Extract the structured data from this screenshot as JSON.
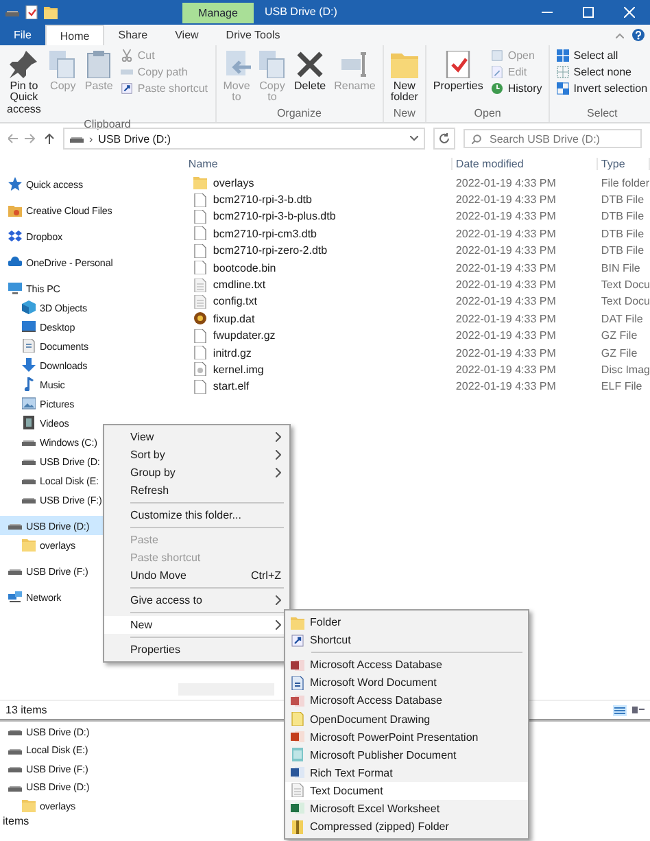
{
  "window": {
    "title": "USB Drive (D:)",
    "contextual_tab": "Manage"
  },
  "ribbon_tabs": [
    {
      "label": "File",
      "kind": "file"
    },
    {
      "label": "Home",
      "selected": true
    },
    {
      "label": "Share",
      "selected": false
    },
    {
      "label": "View",
      "selected": false
    },
    {
      "label": "Drive Tools",
      "selected": false
    }
  ],
  "ribbon_groups": [
    {
      "label": "Clipboard",
      "items": [
        {
          "label": "Pin to Quick access",
          "kind": "large",
          "disabled": false
        },
        {
          "label": "Copy",
          "kind": "large",
          "disabled": true
        },
        {
          "label": "Paste",
          "kind": "large",
          "disabled": true
        },
        {
          "kind": "stack",
          "items": [
            {
              "label": "Cut",
              "disabled": true
            },
            {
              "label": "Copy path",
              "disabled": true
            },
            {
              "label": "Paste shortcut",
              "disabled": true
            }
          ]
        }
      ]
    },
    {
      "label": "Organize",
      "items": [
        {
          "label": "Move to",
          "kind": "large",
          "disabled": true
        },
        {
          "label": "Copy to",
          "kind": "large",
          "disabled": true
        },
        {
          "label": "Delete",
          "kind": "large",
          "disabled": false
        },
        {
          "label": "Rename",
          "kind": "large",
          "disabled": true
        }
      ]
    },
    {
      "label": "New",
      "items": [
        {
          "label": "New folder",
          "kind": "large",
          "disabled": false
        }
      ]
    },
    {
      "label": "Open",
      "items": [
        {
          "label": "Properties",
          "kind": "large",
          "disabled": false
        },
        {
          "kind": "stack",
          "items": [
            {
              "label": "Open",
              "disabled": true
            },
            {
              "label": "Edit",
              "disabled": true
            },
            {
              "label": "History",
              "disabled": false
            }
          ]
        }
      ]
    },
    {
      "label": "Select",
      "items": [
        {
          "kind": "stack",
          "items": [
            {
              "label": "Select all",
              "disabled": false
            },
            {
              "label": "Select none",
              "disabled": false
            },
            {
              "label": "Invert selection",
              "disabled": false
            }
          ]
        }
      ]
    }
  ],
  "address": {
    "separator": "›",
    "path": "USB Drive (D:)",
    "search_placeholder": "Search USB Drive (D:)"
  },
  "nav": [
    {
      "label": "Quick access",
      "kind": "star",
      "selected": false
    },
    {
      "label": "Creative Cloud Files",
      "kind": "cloudfolder",
      "selected": false
    },
    {
      "label": "Dropbox",
      "kind": "box",
      "selected": false
    },
    {
      "label": "OneDrive - Personal",
      "kind": "cloud",
      "selected": false
    },
    {
      "label": "This PC",
      "kind": "pc",
      "selected": false,
      "children": [
        {
          "label": "3D Objects",
          "kind": "cube",
          "selected": false
        },
        {
          "label": "Desktop",
          "kind": "desktop",
          "selected": false
        },
        {
          "label": "Documents",
          "kind": "doc",
          "selected": false
        },
        {
          "label": "Downloads",
          "kind": "download",
          "selected": false
        },
        {
          "label": "Music",
          "kind": "music",
          "selected": false
        },
        {
          "label": "Pictures",
          "kind": "pictures",
          "selected": false
        },
        {
          "label": "Videos",
          "kind": "video",
          "selected": false
        },
        {
          "label": "Windows (C:)",
          "kind": "drive",
          "selected": false
        },
        {
          "label": "USB Drive (D:",
          "kind": "drive",
          "selected": false
        },
        {
          "label": "Local Disk (E:",
          "kind": "drive",
          "selected": false
        },
        {
          "label": "USB Drive (F:)",
          "kind": "drive",
          "selected": false
        }
      ]
    },
    {
      "label": "USB Drive (D:)",
      "kind": "drive",
      "selected": true,
      "children": [
        {
          "label": "overlays",
          "kind": "folder",
          "selected": false
        }
      ]
    },
    {
      "label": "USB Drive (F:)",
      "kind": "drive",
      "selected": false
    },
    {
      "label": "Network",
      "kind": "network",
      "selected": false
    }
  ],
  "table": {
    "columns": [
      "Name",
      "Date modified",
      "Type"
    ],
    "rows": [
      {
        "name": "overlays",
        "date": "2022-01-19 4:33 PM",
        "type": "File folder",
        "kind": "folder"
      },
      {
        "name": "bcm2710-rpi-3-b.dtb",
        "date": "2022-01-19 4:33 PM",
        "type": "DTB File",
        "kind": "file"
      },
      {
        "name": "bcm2710-rpi-3-b-plus.dtb",
        "date": "2022-01-19 4:33 PM",
        "type": "DTB File",
        "kind": "file"
      },
      {
        "name": "bcm2710-rpi-cm3.dtb",
        "date": "2022-01-19 4:33 PM",
        "type": "DTB File",
        "kind": "file"
      },
      {
        "name": "bcm2710-rpi-zero-2.dtb",
        "date": "2022-01-19 4:33 PM",
        "type": "DTB File",
        "kind": "file"
      },
      {
        "name": "bootcode.bin",
        "date": "2022-01-19 4:33 PM",
        "type": "BIN File",
        "kind": "file"
      },
      {
        "name": "cmdline.txt",
        "date": "2022-01-19 4:33 PM",
        "type": "Text Docu",
        "kind": "text"
      },
      {
        "name": "config.txt",
        "date": "2022-01-19 4:33 PM",
        "type": "Text Docu",
        "kind": "text"
      },
      {
        "name": "fixup.dat",
        "date": "2022-01-19 4:33 PM",
        "type": "DAT File",
        "kind": "dat"
      },
      {
        "name": "fwupdater.gz",
        "date": "2022-01-19 4:33 PM",
        "type": "GZ File",
        "kind": "file"
      },
      {
        "name": "initrd.gz",
        "date": "2022-01-19 4:33 PM",
        "type": "GZ File",
        "kind": "file"
      },
      {
        "name": "kernel.img",
        "date": "2022-01-19 4:33 PM",
        "type": "Disc Imag",
        "kind": "image"
      },
      {
        "name": "start.elf",
        "date": "2022-01-19 4:33 PM",
        "type": "ELF File",
        "kind": "file"
      }
    ]
  },
  "status_bar": "13 items",
  "context_menu": [
    {
      "kind": "item",
      "label": "View",
      "submenu": true,
      "disabled": false,
      "highlighted": false
    },
    {
      "kind": "item",
      "label": "Sort by",
      "submenu": true,
      "disabled": false,
      "highlighted": false
    },
    {
      "kind": "item",
      "label": "Group by",
      "submenu": true,
      "disabled": false,
      "highlighted": false
    },
    {
      "kind": "item",
      "label": "Refresh",
      "submenu": false,
      "disabled": false,
      "highlighted": false
    },
    {
      "kind": "separator"
    },
    {
      "kind": "item",
      "label": "Customize this folder...",
      "submenu": false,
      "disabled": false,
      "highlighted": false
    },
    {
      "kind": "separator"
    },
    {
      "kind": "item",
      "label": "Paste",
      "submenu": false,
      "disabled": true,
      "highlighted": false
    },
    {
      "kind": "item",
      "label": "Paste shortcut",
      "submenu": false,
      "disabled": true,
      "highlighted": false
    },
    {
      "kind": "item",
      "label": "Undo Move",
      "shortcut": "Ctrl+Z",
      "submenu": false,
      "disabled": false,
      "highlighted": false
    },
    {
      "kind": "separator"
    },
    {
      "kind": "item",
      "label": "Give access to",
      "submenu": true,
      "disabled": false,
      "highlighted": false
    },
    {
      "kind": "separator"
    },
    {
      "kind": "item",
      "label": "New",
      "submenu": true,
      "disabled": false,
      "highlighted": true
    },
    {
      "kind": "separator"
    },
    {
      "kind": "item",
      "label": "Properties",
      "submenu": false,
      "disabled": false,
      "highlighted": false
    }
  ],
  "new_submenu": [
    {
      "kind": "folder",
      "label": "Folder",
      "highlighted": false
    },
    {
      "kind": "shortcut",
      "label": "Shortcut",
      "highlighted": false
    },
    {
      "kind": "separator"
    },
    {
      "kind": "access",
      "label": "Microsoft Access Database",
      "highlighted": false
    },
    {
      "kind": "word",
      "label": "Microsoft Word Document",
      "highlighted": false
    },
    {
      "kind": "access2",
      "label": "Microsoft Access Database",
      "highlighted": false
    },
    {
      "kind": "odg",
      "label": "OpenDocument Drawing",
      "highlighted": false
    },
    {
      "kind": "powerpoint",
      "label": "Microsoft PowerPoint Presentation",
      "highlighted": false
    },
    {
      "kind": "publisher",
      "label": "Microsoft Publisher Document",
      "highlighted": false
    },
    {
      "kind": "rtf",
      "label": "Rich Text Format",
      "highlighted": false
    },
    {
      "kind": "text",
      "label": "Text Document",
      "highlighted": true
    },
    {
      "kind": "excel",
      "label": "Microsoft Excel Worksheet",
      "highlighted": false
    },
    {
      "kind": "zip",
      "label": "Compressed (zipped) Folder",
      "highlighted": false
    }
  ],
  "second_window": {
    "nav": [
      {
        "label": "USB Drive (D:)",
        "kind": "drive",
        "selected": false
      },
      {
        "label": "Local Disk (E:)",
        "kind": "drive",
        "selected": false
      },
      {
        "label": "USB Drive (F:)",
        "kind": "drive",
        "selected": false
      },
      {
        "label": "USB Drive (D:)",
        "kind": "drive",
        "selected": false,
        "children": [
          {
            "label": "overlays",
            "kind": "folder",
            "selected": false
          }
        ]
      }
    ],
    "status_bar": "items"
  }
}
